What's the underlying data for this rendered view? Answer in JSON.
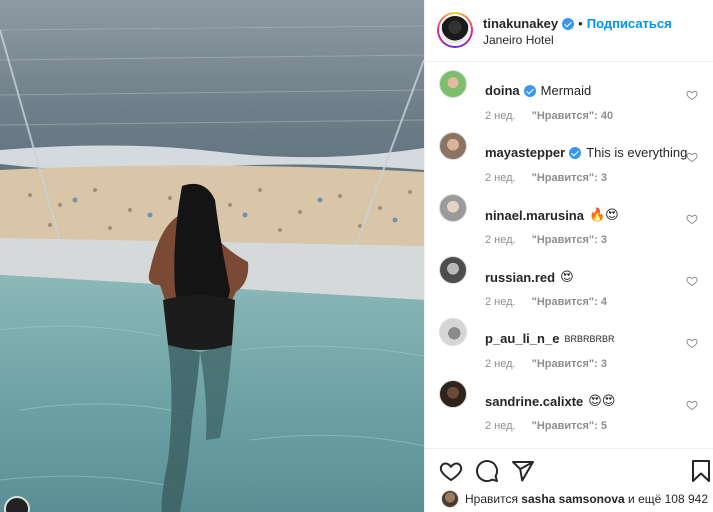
{
  "post": {
    "author": "tinakunakey",
    "author_verified": true,
    "separator": "•",
    "follow_label": "Подписаться",
    "location": "Janeiro Hotel"
  },
  "comments": [
    {
      "user": "doina",
      "verified": true,
      "text": "Mermaid",
      "age": "2 нед.",
      "likes": "\"Нравится\": 40",
      "avatar_color": "#7bbf6a",
      "avatar_icon": "mermaid-avatar"
    },
    {
      "user": "mayastepper",
      "verified": true,
      "text": "This is everything",
      "age": "2 нед.",
      "likes": "\"Нравится\": 3",
      "avatar_color": "#b9a48e",
      "avatar_icon": "face-avatar"
    },
    {
      "user": "ninael.marusina",
      "verified": false,
      "text": "🔥😍",
      "age": "2 нед.",
      "likes": "\"Нравится\": 3",
      "avatar_color": "#9a9a9a",
      "avatar_icon": "face-avatar"
    },
    {
      "user": "russian.red",
      "verified": false,
      "text": "😍",
      "age": "2 нед.",
      "likes": "\"Нравится\": 4",
      "avatar_color": "#6d6d6d",
      "avatar_icon": "face-avatar"
    },
    {
      "user": "p_au_li_n_e",
      "verified": false,
      "text": "BRBRBRBR",
      "age": "2 нед.",
      "likes": "\"Нравится\": 3",
      "avatar_color": "#c9c9c9",
      "avatar_icon": "face-avatar"
    },
    {
      "user": "sandrine.calixte",
      "verified": false,
      "text": "😍😍",
      "age": "2 нед.",
      "likes": "\"Нравится\": 5",
      "avatar_color": "#4a3a2e",
      "avatar_icon": "face-avatar"
    }
  ],
  "likes_summary": {
    "prefix": "Нравится",
    "user": "sasha samsonova",
    "suffix": "и ещё 108 942"
  },
  "icons": {
    "like": "heart-icon",
    "comment": "comment-icon",
    "share": "share-icon",
    "save": "bookmark-icon"
  },
  "colors": {
    "accent": "#0095f6",
    "verified": "#3897f0",
    "meta_text": "#8e8e8e"
  }
}
